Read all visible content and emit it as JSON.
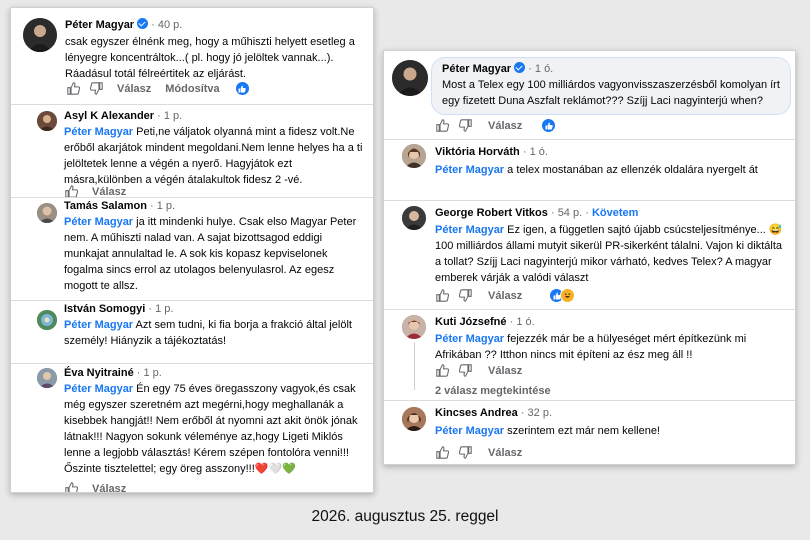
{
  "caption": "2026. augusztus 25. reggel",
  "labels": {
    "reply": "Válasz",
    "edited": "Módosítva",
    "follow": "Követem",
    "dot": "·"
  },
  "left_panel": {
    "top_comment": {
      "author": "Péter Magyar",
      "time": "40 p.",
      "text": "csak egyszer élnénk meg, hogy a műhiszti helyett esetleg a lényegre koncentráltok...( pl. hogy jó jelöltek vannak...). Ráadásul totál félreértitek az eljárást."
    },
    "comments": [
      {
        "author": "Asyl K Alexander",
        "time": "1 p.",
        "mention": "Péter Magyar",
        "text": "Peti,ne váljatok olyanná mint a fidesz volt.Ne erőből akarjátok mindent megoldani.Nem lenne helyes ha a ti jelöltetek lenne a végén a nyerő. Hagyjátok ezt másra,különben a végén átalakultok fidesz 2 -vé."
      },
      {
        "author": "Tamás Salamon",
        "time": "1 p.",
        "mention": "Péter Magyar",
        "text": "ja itt mindenki hulye. Csak elso Magyar Peter nem. A műhiszti nalad van. A sajat bizottsagod eddigi munkajat annulaltad le. A sok kis kopasz kepviselonek fogalma sincs errol az utolagos belenyulasrol. Az egesz mogott te allsz."
      },
      {
        "author": "István Somogyi",
        "time": "1 p.",
        "mention": "Péter Magyar",
        "text": "Azt sem tudni, ki fia borja a frakció által jelölt személy! Hiányzik a tájékoztatás!"
      },
      {
        "author": "Éva Nyitrainé",
        "time": "1 p.",
        "mention": "Péter Magyar",
        "text": "Én egy 75 éves öregasszony vagyok,és csak még egyszer szeretném azt megérni,hogy meghallanák a kisebbek hangját!! Nem erőből át nyomni azt akit önök jónak látnak!!! Nagyon sokunk véleménye az,hogy Ligeti Miklós lenne a legjobb választás! Kérem szépen fontolóra venni!!! Őszinte tisztelettel; egy öreg asszony!!!",
        "emoji": "❤️🤍💚"
      }
    ]
  },
  "right_panel": {
    "top_comment": {
      "author": "Péter Magyar",
      "time": "1 ó.",
      "text": "Most a Telex egy 100 milliárdos vagyonvisszaszerzésből komolyan írt egy fizetett Duna Aszfalt reklámot??? Szíjj Laci nagyinterjú when?"
    },
    "comments": [
      {
        "author": "Viktória Horváth",
        "time": "1 ó.",
        "mention": "Péter Magyar",
        "text": "a telex mostanában az ellenzék oldalára nyergelt át"
      },
      {
        "author": "George Robert Vitkos",
        "time": "54 p.",
        "mention": "Péter Magyar",
        "text": "Ez igen, a független sajtó újabb csúcsteljesítménye... 😅 100 milliárdos állami mutyit sikerül PR-sikerként tálalni. Vajon ki diktálta a tollat? Szíjj Laci nagyinterjú mikor várható, kedves Telex? A magyar emberek várják a valódi választ"
      },
      {
        "author": "Kuti Józsefné",
        "time": "1 ó.",
        "mention": "Péter Magyar",
        "text": "fejezzék már be a hülyeséget mért építkezünk mi Afrikában ?? Itthon nincs mit építeni az ész meg áll !!",
        "replies": "2 válasz megtekintése"
      },
      {
        "author": "Kincses Andrea",
        "time": "32 p.",
        "mention": "Péter Magyar",
        "text": "szerintem ezt már nem kellene!"
      }
    ]
  }
}
